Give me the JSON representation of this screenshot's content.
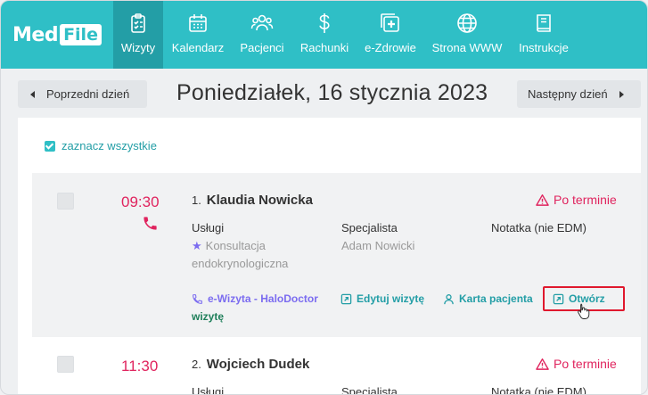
{
  "brand": {
    "med": "Med",
    "file": "File"
  },
  "nav": [
    {
      "label": "Wizyty",
      "icon": "clipboard-icon",
      "active": true
    },
    {
      "label": "Kalendarz",
      "icon": "calendar-icon"
    },
    {
      "label": "Pacjenci",
      "icon": "users-icon"
    },
    {
      "label": "Rachunki",
      "icon": "dollar-icon"
    },
    {
      "label": "e-Zdrowie",
      "icon": "medical-plus-icon"
    },
    {
      "label": "Strona WWW",
      "icon": "globe-icon"
    },
    {
      "label": "Instrukcje",
      "icon": "book-icon"
    }
  ],
  "day": {
    "prev": "Poprzedni dzień",
    "next": "Następny dzień",
    "title": "Poniedziałek, 16 stycznia 2023"
  },
  "select_all": "zaznacz wszystkie",
  "visits": [
    {
      "num": "1.",
      "time": "09:30",
      "name": "Klaudia Nowicka",
      "status": "Po terminie",
      "services_label": "Usługi",
      "service_line1": "Konsultacja",
      "service_line2": "endokrynologiczna",
      "specialist_label": "Specjalista",
      "specialist": "Adam Nowicki",
      "note_label": "Notatka (nie EDM)",
      "ewizyta": "e-Wizyta - HaloDoctor",
      "ewizyta_2": "wizytę",
      "edit": "Edytuj wizytę",
      "card": "Karta pacjenta",
      "open": "Otwórz"
    },
    {
      "num": "2.",
      "time": "11:30",
      "name": "Wojciech Dudek",
      "status": "Po terminie",
      "services_label": "Usługi",
      "specialist_label": "Specjalista",
      "note_label": "Notatka (nie EDM)"
    }
  ],
  "colors": {
    "accent": "#2fbfc6",
    "accent_dark": "#239ea6",
    "danger": "#e0245e",
    "purple": "#7b6cf0"
  }
}
